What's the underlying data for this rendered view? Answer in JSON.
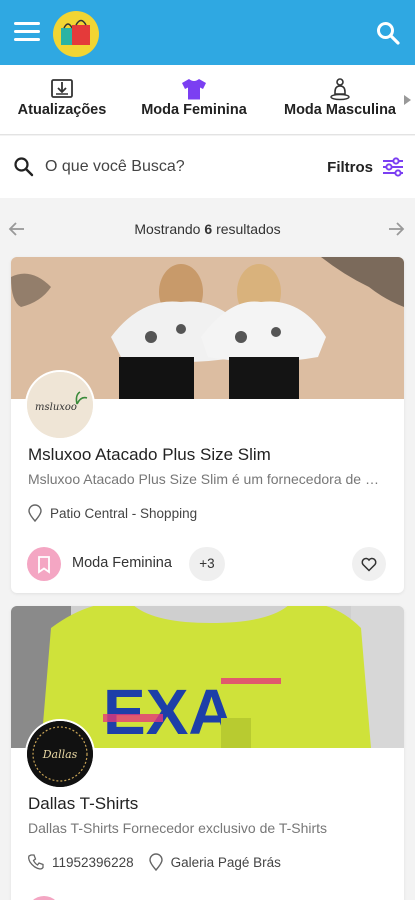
{
  "header": {
    "menu_icon": "hamburger-menu-icon",
    "logo_icon": "shopping-bags-logo",
    "search_icon": "search-icon"
  },
  "categories": [
    {
      "label": "Atualizações",
      "icon": "update-download-icon",
      "color": "#333333"
    },
    {
      "label": "Moda Feminina",
      "icon": "tshirt-icon",
      "color": "#7b3ff2"
    },
    {
      "label": "Moda Masculina",
      "icon": "person-icon",
      "color": "#333333"
    }
  ],
  "search": {
    "placeholder": "O que você Busca?",
    "filters_label": "Filtros",
    "filters_icon": "sliders-icon",
    "accent": "#7b3ff2"
  },
  "results": {
    "prefix": "Mostrando",
    "count": "6",
    "suffix": "resultados"
  },
  "stores": [
    {
      "name": "Msluxoo Atacado Plus Size Slim",
      "description": "Msluxoo Atacado Plus Size Slim é um fornecedora de moda plus size",
      "location": "Patio Central - Shopping",
      "category": "Moda Feminina",
      "extra_categories": "+3",
      "logo_text": "msluxoo"
    },
    {
      "name": "Dallas T-Shirts",
      "description": "Dallas T-Shirts Fornecedor exclusivo de T-Shirts",
      "phone": "11952396228",
      "location": "Galeria Pagé Brás",
      "logo_text": "Dallas"
    }
  ],
  "colors": {
    "appbar": "#2fa8e2",
    "badge_pink": "#f4a6c3",
    "shirt_lime": "#cfe23a"
  }
}
